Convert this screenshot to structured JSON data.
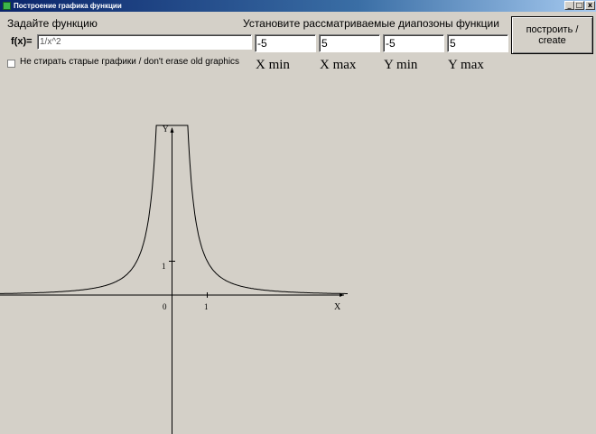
{
  "window": {
    "title": "Построение графика функции",
    "minimize_symbol": "_",
    "maximize_symbol": "□",
    "close_symbol": "x"
  },
  "function_section": {
    "heading": "Задайте функцию",
    "fx_label": "f(x)=",
    "expression": "1/x^2"
  },
  "range_section": {
    "heading": "Установите рассматриваемые диапозоны функции",
    "x_min": {
      "value": "-5",
      "caption": "X min"
    },
    "x_max": {
      "value": "5",
      "caption": "X max"
    },
    "y_min": {
      "value": "-5",
      "caption": "Y min"
    },
    "y_max": {
      "value": "5",
      "caption": "Y max"
    }
  },
  "create_button_label": "построить / create",
  "keep_old_graphs": {
    "label": "Не стирать старые графики / don't erase old graphics",
    "checked": false
  },
  "graph": {
    "function": "1/x^2",
    "x_range": [
      -5,
      5
    ],
    "y_range": [
      -5,
      5
    ],
    "clip_y": 5,
    "axis_labels": {
      "x": "X",
      "y": "Y"
    },
    "tick_labels": {
      "origin": "0",
      "x_unit": "1",
      "y_unit": "1"
    },
    "curve_color": "#000000",
    "axis_color": "#000000"
  }
}
